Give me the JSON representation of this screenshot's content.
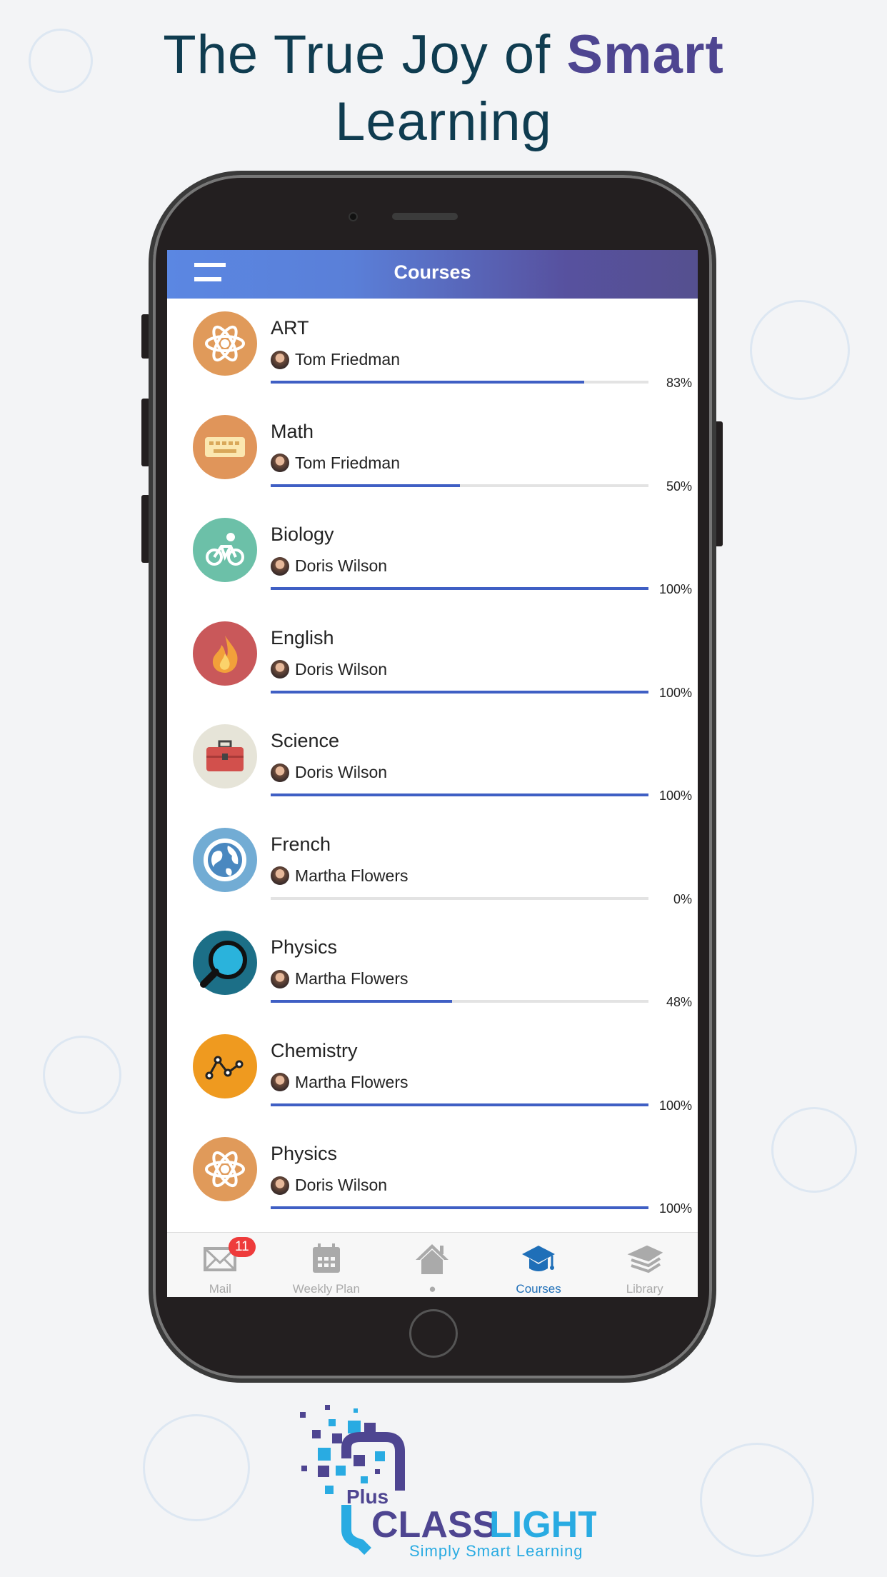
{
  "headline": {
    "prefix": "The True Joy of ",
    "emphasis": "Smart",
    "line2": "Learning"
  },
  "app": {
    "title": "Courses",
    "accent": "#3f5fc4"
  },
  "courses": [
    {
      "name": "ART",
      "teacher": "Tom Friedman",
      "progress": 83,
      "progress_label": "83%",
      "icon": "atom-icon",
      "color": "#e09a5a"
    },
    {
      "name": "Math",
      "teacher": "Tom Friedman",
      "progress": 50,
      "progress_label": "50%",
      "icon": "keyboard-icon",
      "color": "#e0955a"
    },
    {
      "name": "Biology",
      "teacher": "Doris Wilson",
      "progress": 100,
      "progress_label": "100%",
      "icon": "bicycle-icon",
      "color": "#6cc0a8"
    },
    {
      "name": "English",
      "teacher": "Doris Wilson",
      "progress": 100,
      "progress_label": "100%",
      "icon": "flame-icon",
      "color": "#c9585a"
    },
    {
      "name": "Science",
      "teacher": "Doris Wilson",
      "progress": 100,
      "progress_label": "100%",
      "icon": "briefcase-icon",
      "color": "#e6e4d8"
    },
    {
      "name": "French",
      "teacher": "Martha Flowers",
      "progress": 0,
      "progress_label": "0%",
      "icon": "globe-icon",
      "color": "#72acd4"
    },
    {
      "name": "Physics",
      "teacher": "Martha Flowers",
      "progress": 48,
      "progress_label": "48%",
      "icon": "magnifier-icon",
      "color": "#1c6f87"
    },
    {
      "name": "Chemistry",
      "teacher": "Martha Flowers",
      "progress": 100,
      "progress_label": "100%",
      "icon": "line-chart-icon",
      "color": "#ef9a1f"
    },
    {
      "name": "Physics",
      "teacher": "Doris Wilson",
      "progress": 100,
      "progress_label": "100%",
      "icon": "atom-icon",
      "color": "#e09a5a"
    }
  ],
  "tabs": [
    {
      "label": "Mail",
      "icon": "mail-icon",
      "badge": "11"
    },
    {
      "label": "Weekly Plan",
      "icon": "calendar-icon"
    },
    {
      "label": "●",
      "icon": "home-icon"
    },
    {
      "label": "Courses",
      "icon": "graduation-cap-icon",
      "active": true
    },
    {
      "label": "Library",
      "icon": "books-icon"
    }
  ],
  "logo": {
    "plus": "Plus",
    "class": "CLASS",
    "light": "LIGHT",
    "tagline": "Simply Smart Learning"
  }
}
